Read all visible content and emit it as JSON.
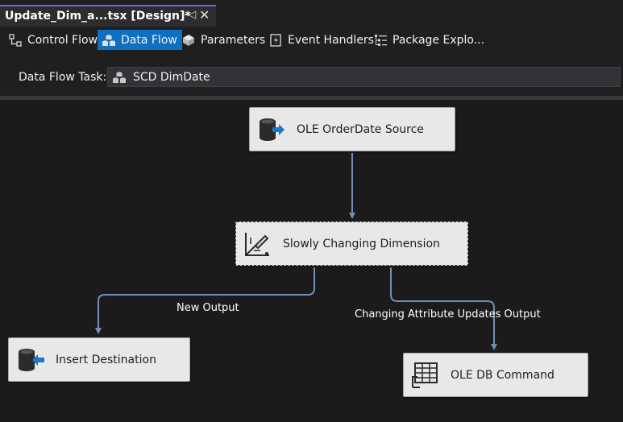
{
  "document_tab": {
    "title": "Update_Dim_a...tsx [Design]*",
    "pin_icon": "pin-icon",
    "close_icon": "close-icon"
  },
  "designer_tabs": [
    {
      "label": "Control Flow",
      "icon": "control-flow-icon",
      "active": false
    },
    {
      "label": "Data Flow",
      "icon": "data-flow-icon",
      "active": true
    },
    {
      "label": "Parameters",
      "icon": "parameters-icon",
      "active": false
    },
    {
      "label": "Event Handlers",
      "icon": "event-handlers-icon",
      "active": false
    },
    {
      "label": "Package Explo...",
      "icon": "package-explorer-icon",
      "active": false
    }
  ],
  "data_flow_task": {
    "label": "Data Flow Task:",
    "selected": "SCD DimDate",
    "icon": "data-flow-task-icon"
  },
  "components": {
    "source": {
      "label": "OLE OrderDate Source",
      "icon": "ole-source-icon"
    },
    "scd": {
      "label": "Slowly Changing Dimension",
      "icon": "scd-icon"
    },
    "insert_dest": {
      "label": "Insert Destination",
      "icon": "ole-destination-icon"
    },
    "ole_command": {
      "label": "OLE DB Command",
      "icon": "ole-db-command-icon"
    }
  },
  "paths": {
    "new_output": "New Output",
    "changing_output": "Changing Attribute Updates Output"
  },
  "colors": {
    "accent": "#7160e8",
    "active_tab": "#0e70c0",
    "connector": "#6f8fb8",
    "component_bg": "#e8e8e8"
  }
}
